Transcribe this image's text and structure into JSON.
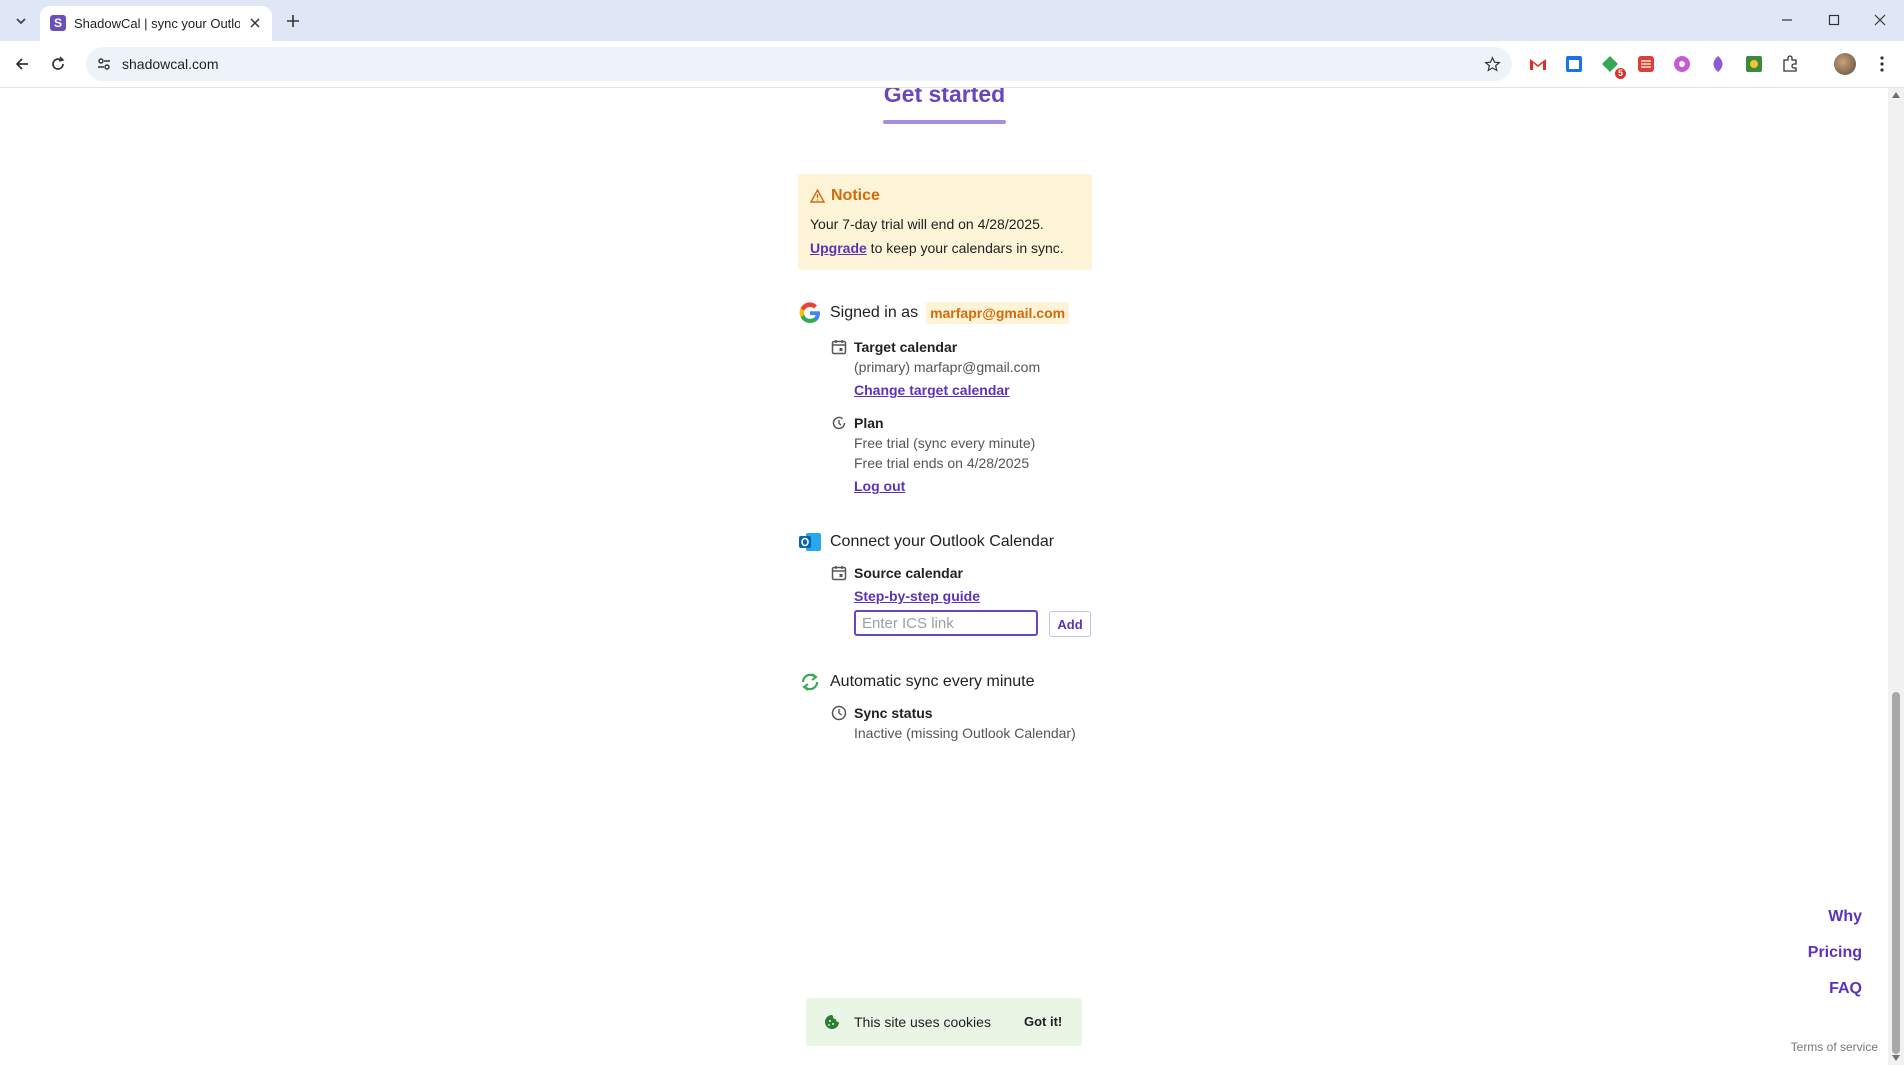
{
  "browser": {
    "tab_title": "ShadowCal | sync your Outlook",
    "tab_favicon_letter": "S",
    "url": "shadowcal.com",
    "extension_badge": "5"
  },
  "page": {
    "heading": "Get started",
    "notice": {
      "title": "Notice",
      "line1": "Your 7-day trial will end on 4/28/2025.",
      "upgrade_link": "Upgrade",
      "line2_rest": " to keep your calendars in sync."
    },
    "account": {
      "signed_in_label": "Signed in as",
      "email": "marfapr@gmail.com",
      "target_calendar": {
        "title": "Target calendar",
        "value": "(primary) marfapr@gmail.com",
        "change_link": "Change target calendar"
      },
      "plan": {
        "title": "Plan",
        "line1": "Free trial (sync every minute)",
        "line2": "Free trial ends on 4/28/2025",
        "logout_link": "Log out"
      }
    },
    "outlook": {
      "heading": "Connect your Outlook Calendar",
      "source_title": "Source calendar",
      "guide_link": "Step-by-step guide",
      "ics_placeholder": "Enter ICS link",
      "ics_value": "",
      "add_button": "Add"
    },
    "sync": {
      "heading": "Automatic sync every minute",
      "status_title": "Sync status",
      "status_value": "Inactive (missing Outlook Calendar)"
    },
    "side_nav": [
      "Why",
      "Pricing",
      "FAQ"
    ],
    "terms": "Terms of service",
    "cookie": {
      "text": "This site uses cookies",
      "button": "Got it!"
    }
  },
  "colors": {
    "accent": "#6a45c2",
    "link": "#5b33b8",
    "notice_bg": "#fdf3d6",
    "notice_text": "#d56a0a",
    "cookie_bg": "#e9f6e6"
  }
}
